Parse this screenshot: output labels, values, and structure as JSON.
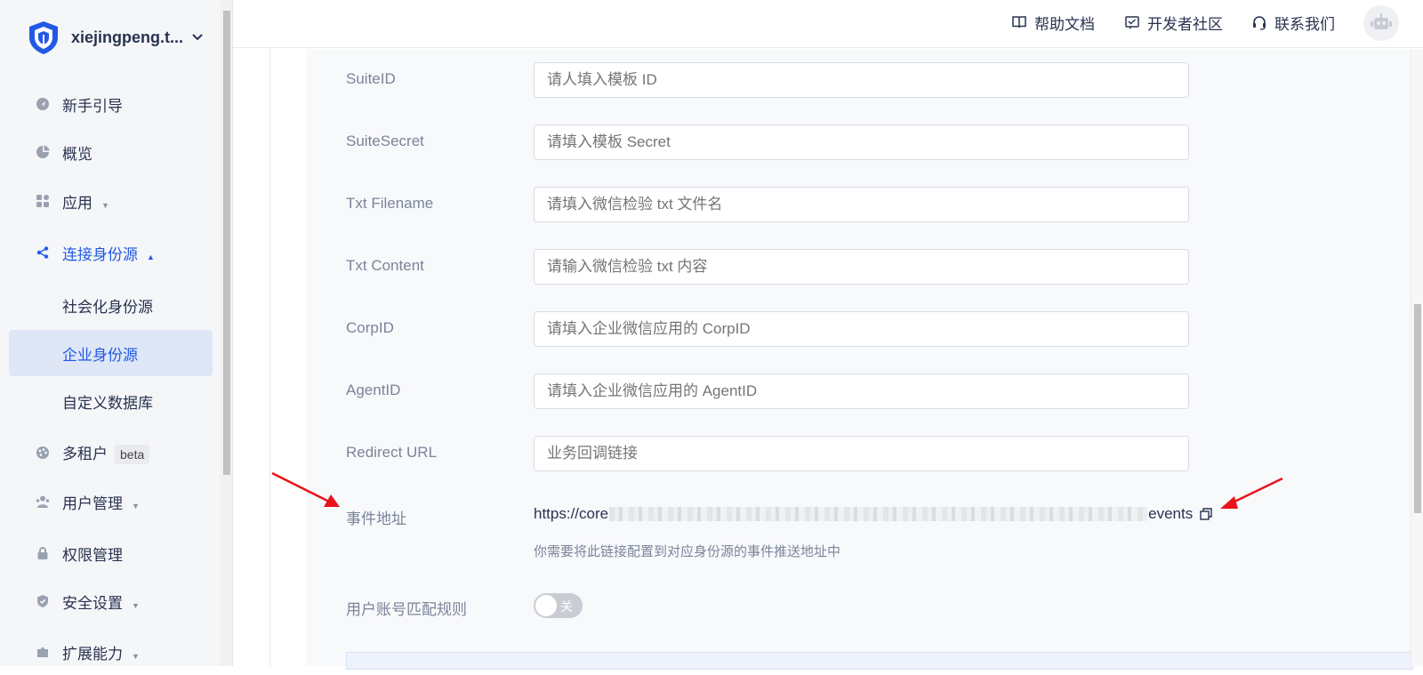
{
  "brand": {
    "name": "xiejingpeng.t...",
    "logo_icon": "shield-logo-icon"
  },
  "sidebar": {
    "items": [
      {
        "label": "新手引导",
        "icon": "rocket-icon"
      },
      {
        "label": "概览",
        "icon": "pie-chart-icon"
      },
      {
        "label": "应用",
        "icon": "grid-icon"
      },
      {
        "label": "连接身份源",
        "icon": "share-icon"
      },
      {
        "label": "社会化身份源"
      },
      {
        "label": "企业身份源"
      },
      {
        "label": "自定义数据库"
      },
      {
        "label": "多租户",
        "icon": "palette-icon",
        "badge": "beta"
      },
      {
        "label": "用户管理",
        "icon": "users-icon"
      },
      {
        "label": "权限管理",
        "icon": "lock-icon"
      },
      {
        "label": "安全设置",
        "icon": "shield-icon"
      },
      {
        "label": "扩展能力",
        "icon": "puzzle-icon"
      }
    ]
  },
  "header": {
    "links": [
      {
        "label": "帮助文档",
        "icon": "book-icon"
      },
      {
        "label": "开发者社区",
        "icon": "community-icon"
      },
      {
        "label": "联系我们",
        "icon": "headset-icon"
      }
    ],
    "avatar_icon": "robot-avatar-icon"
  },
  "form": {
    "fields": [
      {
        "label": "SuiteID",
        "placeholder": "请人填入模板 ID"
      },
      {
        "label": "SuiteSecret",
        "placeholder": "请填入模板 Secret"
      },
      {
        "label": "Txt Filename",
        "placeholder": "请填入微信检验 txt 文件名"
      },
      {
        "label": "Txt Content",
        "placeholder": "请输入微信检验 txt 内容"
      },
      {
        "label": "CorpID",
        "placeholder": "请填入企业微信应用的 CorpID"
      },
      {
        "label": "AgentID",
        "placeholder": "请填入企业微信应用的 AgentID"
      },
      {
        "label": "Redirect URL",
        "placeholder": "业务回调链接"
      }
    ],
    "event": {
      "label": "事件地址",
      "url_prefix": "https://core",
      "url_suffix": "events",
      "hint": "你需要将此链接配置到对应身份源的事件推送地址中"
    },
    "match_rule": {
      "label": "用户账号匹配规则",
      "toggle_text": "关"
    }
  },
  "colors": {
    "accent": "#215ae5",
    "annotation_arrow": "#e8141a"
  }
}
